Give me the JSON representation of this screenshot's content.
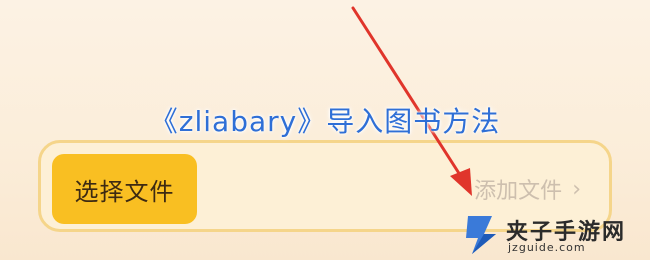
{
  "headline": "《zliabary》导入图书方法",
  "panel": {
    "select_file_label": "选择文件",
    "add_file_label": "添加文件",
    "chevron": "›"
  },
  "watermark": {
    "name": "夹子手游网",
    "domain": "jzguide.com"
  },
  "colors": {
    "accent": "#f9bf22",
    "title": "#2f6fd6",
    "arrow": "#e0352b"
  },
  "icons": [
    "chevron-right-icon",
    "red-arrow-annotation",
    "watermark-logo-icon"
  ]
}
